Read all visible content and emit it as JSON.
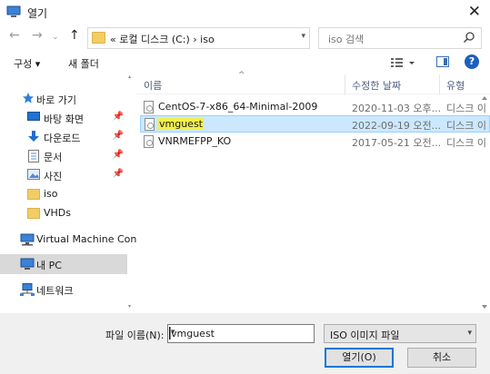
{
  "window": {
    "title": "열기"
  },
  "nav": {
    "address_path": "«  로컬 디스크 (C:)  ›  iso",
    "search_placeholder": "iso 검색"
  },
  "toolbar": {
    "organize_label": "구성 ▾",
    "new_folder_label": "새 폴더"
  },
  "sidebar": {
    "items": [
      {
        "label": "바로 가기",
        "icon": "star-icon"
      },
      {
        "label": "바탕 화면",
        "icon": "desktop-icon",
        "pinned": true
      },
      {
        "label": "다운로드",
        "icon": "download-icon",
        "pinned": true
      },
      {
        "label": "문서",
        "icon": "document-icon",
        "pinned": true
      },
      {
        "label": "사진",
        "icon": "pictures-icon",
        "pinned": true
      },
      {
        "label": "iso",
        "icon": "folder-icon"
      },
      {
        "label": "VHDs",
        "icon": "folder-icon"
      },
      {
        "label": "Virtual Machine Con",
        "icon": "network-computer-icon"
      },
      {
        "label": "내 PC",
        "icon": "pc-icon",
        "selected": true
      },
      {
        "label": "네트워크",
        "icon": "network-icon"
      }
    ]
  },
  "file_list": {
    "columns": [
      "이름",
      "수정한 날짜",
      "유형"
    ],
    "rows": [
      {
        "name": "CentOS-7-x86_64-Minimal-2009",
        "date": "2020-11-03 오후...",
        "type": "디스크 이"
      },
      {
        "name": "vmguest",
        "date": "2022-09-19 오전...",
        "type": "디스크 이",
        "selected": true
      },
      {
        "name": "VNRMEFPP_KO",
        "date": "2017-05-21 오전...",
        "type": "디스크 이"
      }
    ]
  },
  "footer": {
    "filename_label": "파일 이름(N):",
    "filename_value": "vmguest",
    "filter_value": "ISO 이미지 파일",
    "open_label": "열기(O)",
    "cancel_label": "취소"
  },
  "colors": {
    "selection_bg": "#cce8ff",
    "selection_border": "#99d1ff",
    "highlight": "#f3f04a",
    "folder": "#f2cd63",
    "accent": "#0078d7"
  }
}
